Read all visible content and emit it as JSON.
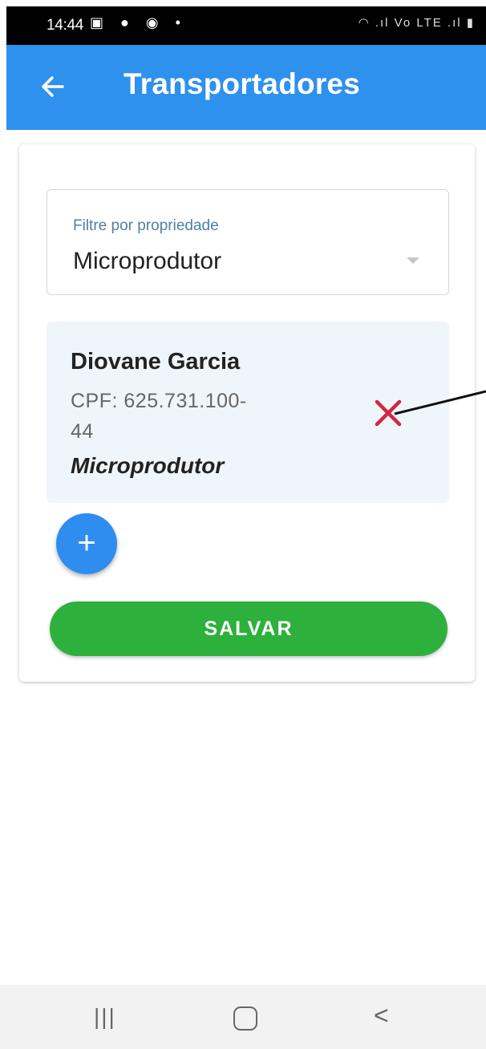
{
  "status_bar": {
    "time": "14:44",
    "left_icons": "▣ ● ◉ •",
    "right_icons": "◠ .ıl Vo LTE .ıl ▮"
  },
  "app_bar": {
    "back_icon": "arrow-left-icon",
    "title": "Transportadores",
    "color": "#2e91ee"
  },
  "filter": {
    "label": "Filtre por propriedade",
    "value": "Microprodutor"
  },
  "transporters": [
    {
      "name": "Diovane Garcia",
      "cpf_line1": "CPF: 625.731.100-",
      "cpf_line2": "44",
      "type": "Microprodutor",
      "remove_icon": "close-icon",
      "remove_color": "#d2283f"
    }
  ],
  "actions": {
    "add_label": "+",
    "save_label": "SALVAR",
    "save_color": "#2eb03c"
  },
  "nav_bar": {
    "recent_icon": "|||",
    "home_icon": "home-icon",
    "back_icon": "<"
  }
}
